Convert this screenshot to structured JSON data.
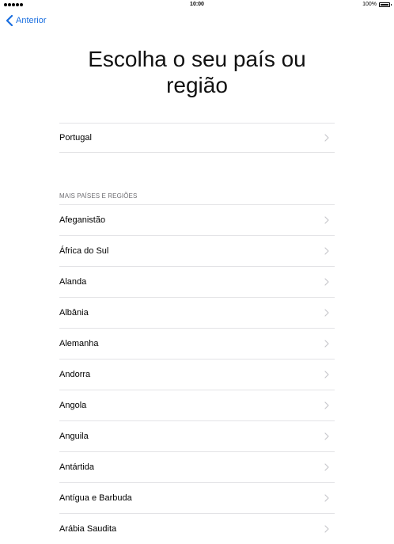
{
  "status_bar": {
    "time": "10:00",
    "battery": "100%",
    "battery_level": 1.0
  },
  "nav": {
    "back_label": "Anterior",
    "back_icon": "chevron-left-icon"
  },
  "page": {
    "title_line1": "Escolha o seu país ou",
    "title_line2": "região"
  },
  "suggested": {
    "items": [
      {
        "label": "Portugal"
      }
    ]
  },
  "more": {
    "header": "MAIS PAÍSES E REGIÕES",
    "items": [
      {
        "label": "Afeganistão"
      },
      {
        "label": "África do Sul"
      },
      {
        "label": "Alanda"
      },
      {
        "label": "Albânia"
      },
      {
        "label": "Alemanha"
      },
      {
        "label": "Andorra"
      },
      {
        "label": "Angola"
      },
      {
        "label": "Anguila"
      },
      {
        "label": "Antártida"
      },
      {
        "label": "Antígua e Barbuda"
      },
      {
        "label": "Arábia Saudita"
      }
    ]
  },
  "colors": {
    "accent": "#1a6fe0",
    "separator": "#e3e3e6",
    "chevron": "#c7c7cc",
    "section_header": "#6d6d72"
  }
}
